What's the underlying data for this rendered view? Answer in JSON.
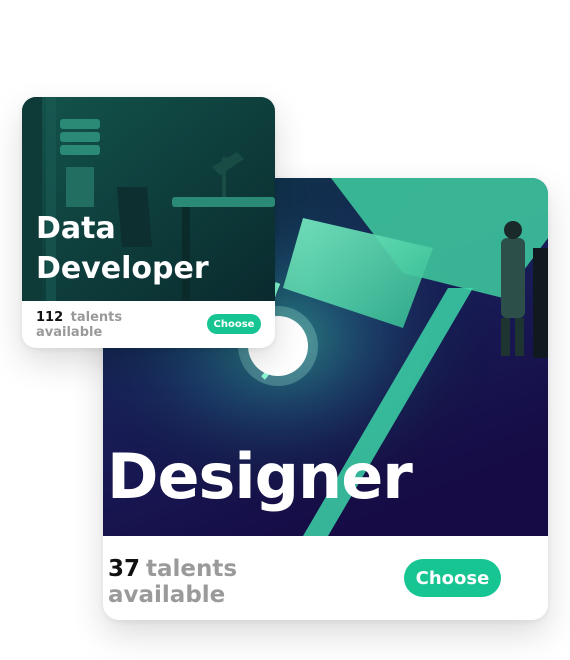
{
  "cards": {
    "designer": {
      "title": "Designer",
      "count": "37",
      "count_label": "talents",
      "count_label2": "available",
      "choose_label": "Choose"
    },
    "data_developer": {
      "title_line1": "Data",
      "title_line2": "Developer",
      "count": "112",
      "count_label": "talents",
      "count_label2": "available",
      "choose_label": "Choose"
    }
  },
  "colors": {
    "accent": "#17c592",
    "muted_text": "#9a9a9a",
    "dark_text": "#111111",
    "designer_bg_top": "#0b2e3f",
    "designer_bg_bottom": "#1a0f4f",
    "data_dev_bg": "#0f3f3a"
  },
  "icons": []
}
